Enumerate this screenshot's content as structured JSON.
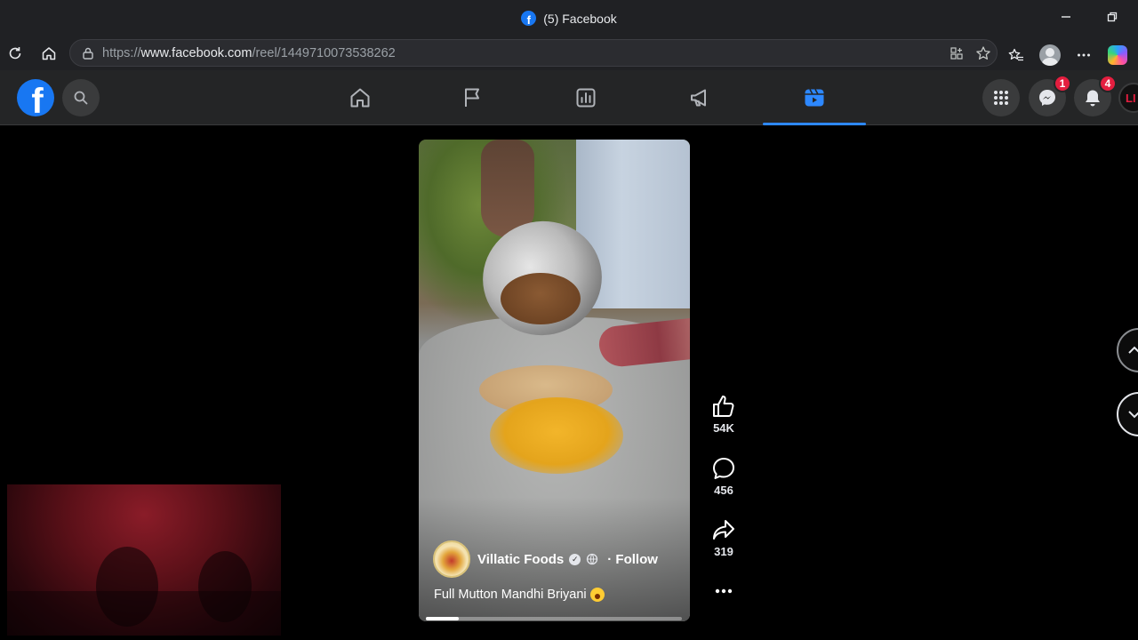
{
  "browser": {
    "tab_title": "(5) Facebook",
    "url_prefix": "https://",
    "url_host": "www.facebook.com",
    "url_path": "/reel/1449710073538262"
  },
  "facebook": {
    "tabs": [
      {
        "name": "home",
        "active": false
      },
      {
        "name": "pages",
        "active": false
      },
      {
        "name": "insights",
        "active": false
      },
      {
        "name": "ads",
        "active": false
      },
      {
        "name": "reels",
        "active": true
      }
    ],
    "messenger_badge": "1",
    "notifications_badge": "4",
    "profile_initials": "LI"
  },
  "reel": {
    "author": "Villatic Foods",
    "follow_label": "· Follow",
    "caption": "Full Mutton Mandhi Briyani",
    "progress_fraction": 0.13,
    "likes": "54K",
    "comments": "456",
    "shares": "319"
  },
  "colors": {
    "fb_blue": "#1877f2",
    "active_tab": "#2d88ff",
    "badge_red": "#e41e3f",
    "header_bg": "#242526"
  }
}
